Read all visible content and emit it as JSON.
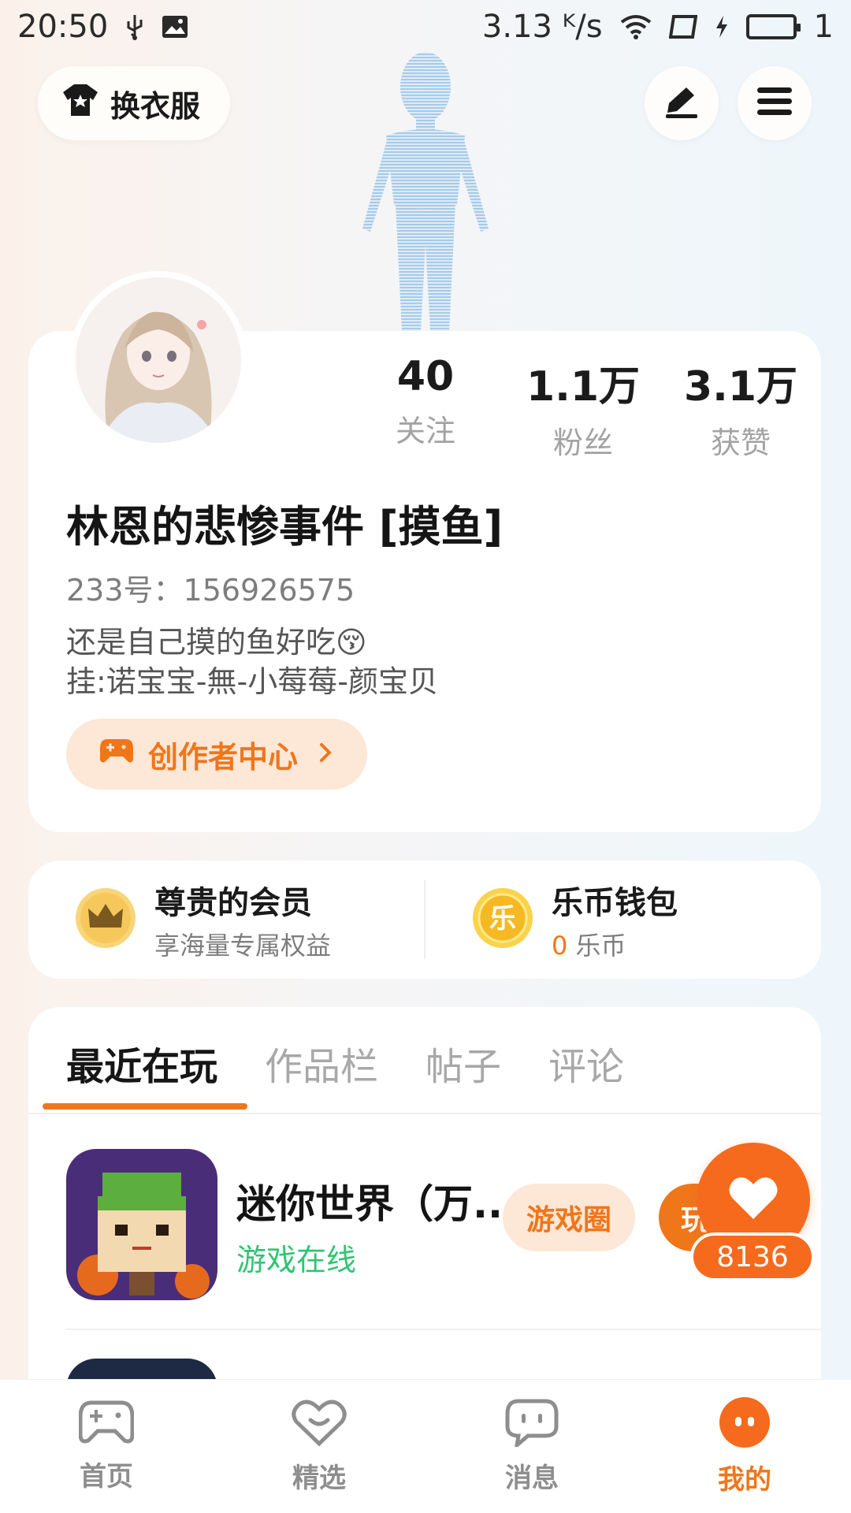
{
  "status_bar": {
    "time": "20:50",
    "network_speed": "3.13 ᴷ/s",
    "battery_text": "1"
  },
  "header": {
    "change_outfit_label": "换衣服"
  },
  "profile": {
    "stats": [
      {
        "value": "40",
        "label": "关注"
      },
      {
        "value": "1.1万",
        "label": "粉丝"
      },
      {
        "value": "3.1万",
        "label": "获赞"
      }
    ],
    "username": "林恩的悲惨事件  [摸鱼]",
    "uid": "233号：156926575",
    "bio_line1": "还是自己摸的鱼好吃😚",
    "bio_line2": "挂:诺宝宝-無-小莓莓-颜宝贝",
    "creator_center_label": "创作者中心"
  },
  "vip": {
    "member_title": "尊贵的会员",
    "member_sub": "享海量专属权益",
    "wallet_title": "乐币钱包",
    "wallet_amount": "0",
    "wallet_unit": " 乐币",
    "coin_glyph": "乐"
  },
  "tabs": [
    {
      "label": "最近在玩",
      "active": true
    },
    {
      "label": "作品栏",
      "active": false
    },
    {
      "label": "帖子",
      "active": false
    },
    {
      "label": "评论",
      "active": false
    }
  ],
  "games": [
    {
      "name": "迷你世界（万..",
      "status": "游戏在线",
      "circle_label": "游戏圈",
      "play_label": "玩"
    }
  ],
  "fab": {
    "count": "8136"
  },
  "bottom_nav": [
    {
      "label": "首页",
      "icon": "gamepad-icon",
      "active": false
    },
    {
      "label": "精选",
      "icon": "heart-chat-icon",
      "active": false
    },
    {
      "label": "消息",
      "icon": "message-icon",
      "active": false
    },
    {
      "label": "我的",
      "icon": "face-icon",
      "active": true
    }
  ],
  "colors": {
    "accent": "#f0761a",
    "online_green": "#31c474",
    "accent_light": "#fde7d7"
  }
}
